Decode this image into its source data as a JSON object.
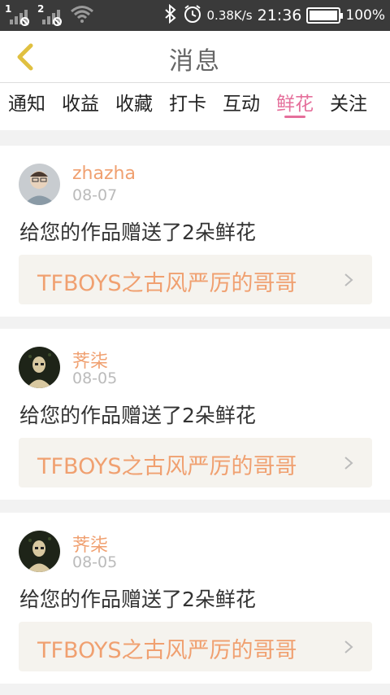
{
  "status_bar": {
    "sim1": "1",
    "sim2": "2",
    "net_speed": "0.38K/s",
    "time": "21:36",
    "battery": "100%"
  },
  "header": {
    "title": "消息",
    "back_icon": "chevron-left-icon"
  },
  "tabs": [
    {
      "label": "通知",
      "active": false
    },
    {
      "label": "收益",
      "active": false
    },
    {
      "label": "收藏",
      "active": false
    },
    {
      "label": "打卡",
      "active": false
    },
    {
      "label": "互动",
      "active": false
    },
    {
      "label": "鲜花",
      "active": true
    },
    {
      "label": "关注",
      "active": false
    }
  ],
  "colors": {
    "accent_pink": "#e56f9b",
    "username_orange": "#f0a070",
    "back_icon": "#e0c040"
  },
  "messages": [
    {
      "username": "zhazha",
      "date": "08-07",
      "text": "给您的作品赠送了2朵鲜花",
      "work_title": "TFBOYS之古风严厉的哥哥"
    },
    {
      "username": "荠柒",
      "date": "08-05",
      "text": "给您的作品赠送了2朵鲜花",
      "work_title": "TFBOYS之古风严厉的哥哥"
    },
    {
      "username": "荠柒",
      "date": "08-05",
      "text": "给您的作品赠送了2朵鲜花",
      "work_title": "TFBOYS之古风严厉的哥哥"
    }
  ]
}
